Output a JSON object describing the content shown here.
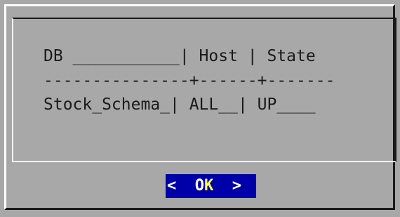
{
  "table": {
    "header": "DB ___________| Host | State",
    "separator": "---------------+------+-------",
    "rows": [
      "Stock_Schema_| ALL__| UP____"
    ]
  },
  "buttons": {
    "ok": {
      "left_bracket": "<",
      "first": "O",
      "hotkey": "K",
      "right_bracket": ">"
    }
  },
  "colors": {
    "background": "#a8a8a8",
    "button_bg": "#0000a8",
    "button_text": "#ffffff",
    "hotkey": "#ffff55"
  }
}
